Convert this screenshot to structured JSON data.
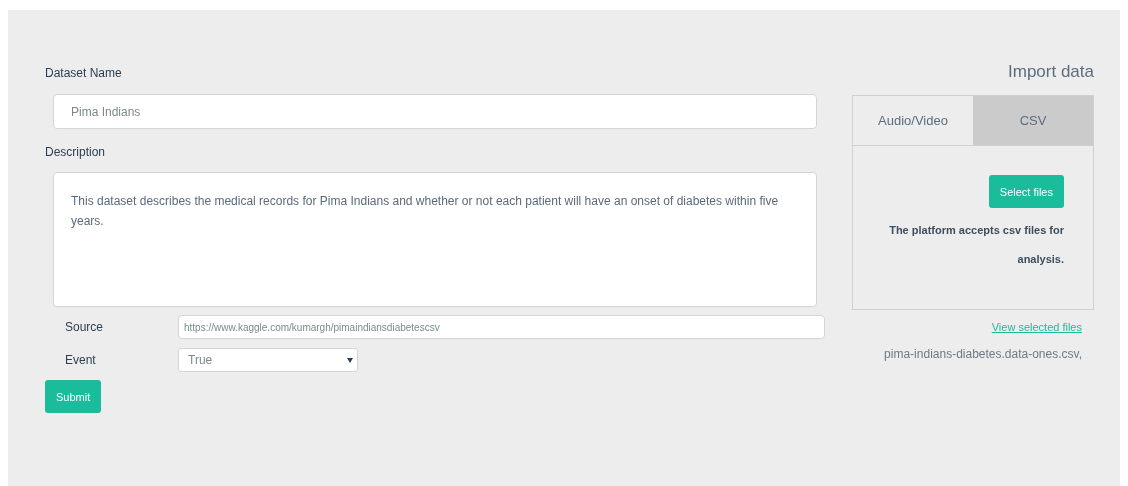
{
  "form": {
    "dataset_name_label": "Dataset Name",
    "dataset_name_value": "Pima Indians",
    "description_label": "Description",
    "description_value": "This dataset describes the medical records for Pima Indians and whether or not each patient will have an onset of diabetes within five years.",
    "source_label": "Source",
    "source_value": "https://www.kaggle.com/kumargh/pimaindiansdiabetescsv",
    "event_label": "Event",
    "event_value": "True",
    "submit": "Submit"
  },
  "import": {
    "title": "Import data",
    "tabs": [
      {
        "label": "Audio/Video",
        "selected": false
      },
      {
        "label": "CSV",
        "selected": true
      }
    ],
    "select_button": "Select files",
    "note": "The platform accepts csv files for analysis.",
    "link": "View selected files",
    "file_list": "pima-indians-diabetes.data-ones.csv,"
  }
}
